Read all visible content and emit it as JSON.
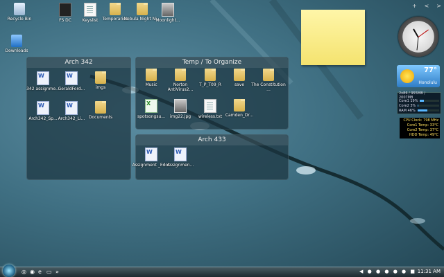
{
  "desktop": {
    "icons": [
      {
        "name": "recycle-bin",
        "label": "Recycle Bin",
        "type": "recycle"
      },
      {
        "name": "downloads",
        "label": "Downloads",
        "type": "download"
      },
      {
        "name": "fs-dc",
        "label": "FS DC",
        "type": "dark"
      },
      {
        "name": "keyslist",
        "label": "Keyslist",
        "type": "doc"
      },
      {
        "name": "temporary",
        "label": "Temporaries",
        "type": "folder"
      },
      {
        "name": "nightlight",
        "label": "Nebula Night Ni...",
        "type": "folder"
      },
      {
        "name": "moonlight",
        "label": "Moonlight...",
        "type": "image"
      }
    ]
  },
  "fences": {
    "arch342": {
      "title": "Arch 342",
      "items": [
        {
          "label": "342 assignme...",
          "type": "word"
        },
        {
          "label": "GeraldFord...",
          "type": "word"
        },
        {
          "label": "imgs",
          "type": "folder"
        },
        {
          "label": "Arch342_Sp...",
          "type": "word"
        },
        {
          "label": "Arch342_Li...",
          "type": "word"
        },
        {
          "label": "Documents",
          "type": "folder"
        }
      ]
    },
    "temp": {
      "title": "Temp / To Organize",
      "items": [
        {
          "label": "Music",
          "type": "folder"
        },
        {
          "label": "Norton AntiVirus2...",
          "type": "folder"
        },
        {
          "label": "T_P_T09_R",
          "type": "folder"
        },
        {
          "label": "save",
          "type": "folder"
        },
        {
          "label": "The Constitution ...",
          "type": "folder"
        },
        {
          "label": "spotsongsu...",
          "type": "excel"
        },
        {
          "label": "img22.jpg",
          "type": "image"
        },
        {
          "label": "wireless.txt",
          "type": "doc"
        },
        {
          "label": "Camden_Dr...",
          "type": "folder"
        }
      ]
    },
    "arch433": {
      "title": "Arch 433",
      "items": [
        {
          "label": "Assignment _Edoc",
          "type": "word"
        },
        {
          "label": "Assignmen...",
          "type": "word"
        }
      ]
    }
  },
  "gadgets": {
    "sidebar_controls": [
      "+",
      "<",
      ">"
    ],
    "weather": {
      "temp": "77°",
      "city": "Honolulu"
    },
    "cpu": {
      "header": "2x86 / 955MB / 2007MB",
      "rows": [
        {
          "label": "Core1",
          "value": "19%",
          "pct": 0.19
        },
        {
          "label": "Core2",
          "value": "3%",
          "pct": 0.03
        },
        {
          "label": "RAM",
          "value": "46%",
          "pct": 0.46
        }
      ]
    },
    "temps": [
      "CPU Clock: 798 MHz",
      "Core1 Temp: 33°C",
      "Core2 Temp: 37°C",
      "HDD Temp: 49°C"
    ]
  },
  "taskbar": {
    "quick_launch": [
      "»"
    ],
    "tray_icons": [
      "◀",
      "●",
      "●",
      "●",
      "●",
      "●",
      "■"
    ],
    "time": "11:31 AM"
  },
  "colors": {
    "accent": "#4f86a0",
    "note": "#f8e97f",
    "taskbar": "#1e2a30"
  }
}
